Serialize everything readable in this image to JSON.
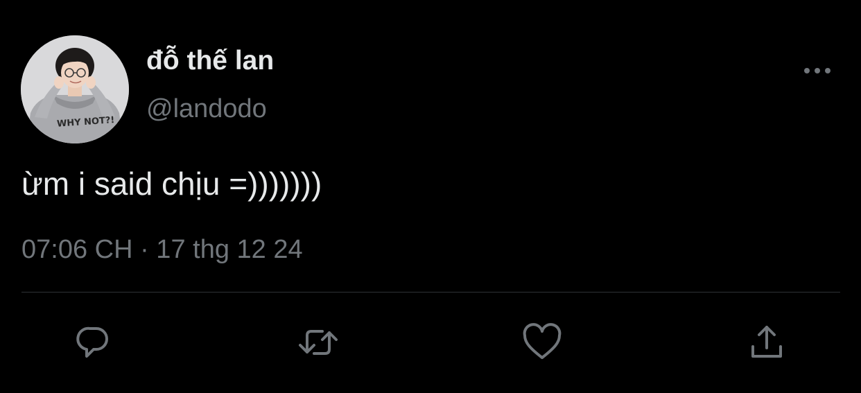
{
  "tweet": {
    "author": {
      "display_name": "đỗ thế lan",
      "handle": "@landodo",
      "avatar_shirt_text": "WHY NOT?!"
    },
    "text": "ừm i said chịu =)))))))",
    "timestamp": "07:06 CH · 17 thg 12 24"
  },
  "actions": {
    "reply": "reply-icon",
    "retweet": "retweet-icon",
    "like": "heart-icon",
    "share": "share-icon",
    "more": "more-horizontal-icon"
  },
  "colors": {
    "background": "#000000",
    "primary_text": "#e7e9ea",
    "secondary_text": "#71767b",
    "divider": "#2f3336",
    "icon": "#71767b"
  }
}
